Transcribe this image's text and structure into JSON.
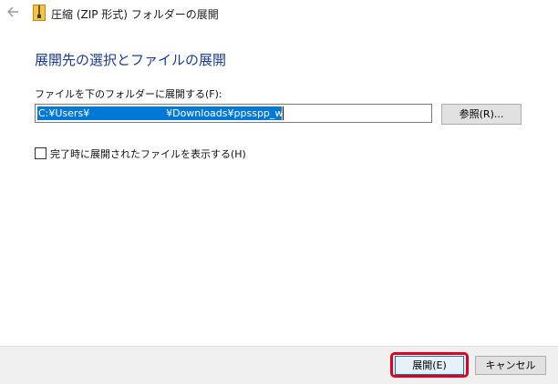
{
  "window": {
    "title": "圧縮 (ZIP 形式) フォルダーの展開"
  },
  "heading": "展開先の選択とファイルの展開",
  "destination": {
    "label": "ファイルを下のフォルダーに展開する(F):",
    "path_value": "C:¥Users¥                        ¥Downloads¥ppsspp_win",
    "browse_label": "参照(R)..."
  },
  "options": {
    "show_files_label": "完了時に展開されたファイルを表示する(H)",
    "show_files_checked": false
  },
  "footer": {
    "extract_label": "展開(E)",
    "cancel_label": "キャンセル"
  },
  "icons": {
    "back": "back-arrow-icon",
    "window": "zip-folder-icon"
  },
  "colors": {
    "heading": "#1d3c93",
    "selection": "#0078d7",
    "highlight_outline": "#e0001a",
    "footer_bg": "#f0f0f0"
  }
}
